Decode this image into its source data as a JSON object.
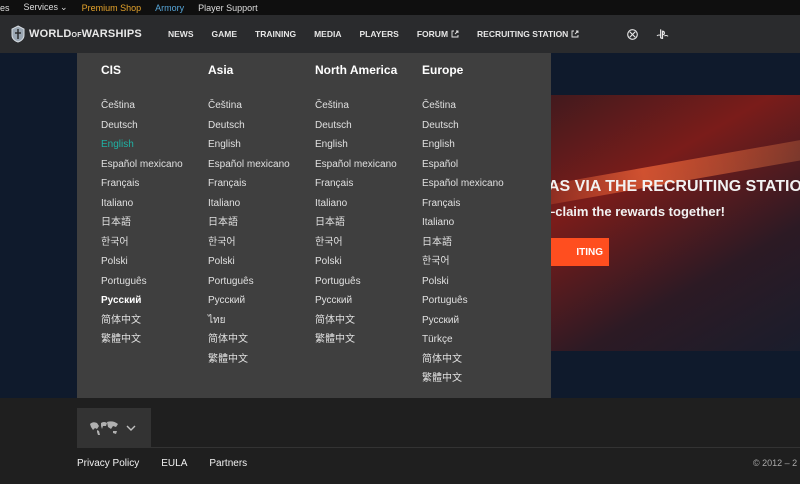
{
  "topbar": {
    "games_label": "es",
    "services_label": "Services",
    "premium_label": "Premium Shop",
    "armory_label": "Armory",
    "support_label": "Player Support"
  },
  "nav": {
    "logo_text_a": "WORLD",
    "logo_text_of": "OF",
    "logo_text_b": "WARSHIPS",
    "items": [
      "NEWS",
      "GAME",
      "TRAINING",
      "MEDIA",
      "PLAYERS",
      "FORUM",
      "RECRUITING STATION"
    ]
  },
  "banner": {
    "title": "AS VIA THE RECRUITING STATION",
    "subtitle": "–claim the rewards together!",
    "button_label": "ITING"
  },
  "regions": [
    {
      "name": "CIS",
      "languages": [
        "Čeština",
        "Deutsch",
        "English",
        "Español mexicano",
        "Français",
        "Italiano",
        "日本語",
        "한국어",
        "Polski",
        "Português",
        "Русский",
        "简体中文",
        "繁體中文"
      ]
    },
    {
      "name": "Asia",
      "languages": [
        "Čeština",
        "Deutsch",
        "English",
        "Español mexicano",
        "Français",
        "Italiano",
        "日本語",
        "한국어",
        "Polski",
        "Português",
        "Русский",
        "ไทย",
        "简体中文",
        "繁體中文"
      ]
    },
    {
      "name": "North America",
      "languages": [
        "Čeština",
        "Deutsch",
        "English",
        "Español mexicano",
        "Français",
        "Italiano",
        "日本語",
        "한국어",
        "Polski",
        "Português",
        "Русский",
        "简体中文",
        "繁體中文"
      ]
    },
    {
      "name": "Europe",
      "languages": [
        "Čeština",
        "Deutsch",
        "English",
        "Español",
        "Español mexicano",
        "Français",
        "Italiano",
        "日本語",
        "한국어",
        "Polski",
        "Português",
        "Русский",
        "Türkçe",
        "简体中文",
        "繁體中文"
      ]
    }
  ],
  "footer": {
    "links": [
      "Privacy Policy",
      "EULA",
      "Partners"
    ],
    "copyright": "© 2012 – 2"
  },
  "colors": {
    "active_language": "#1fb2a4",
    "premium": "#e5a32b",
    "armory": "#57a6d8",
    "cta": "#ff4e1f"
  }
}
